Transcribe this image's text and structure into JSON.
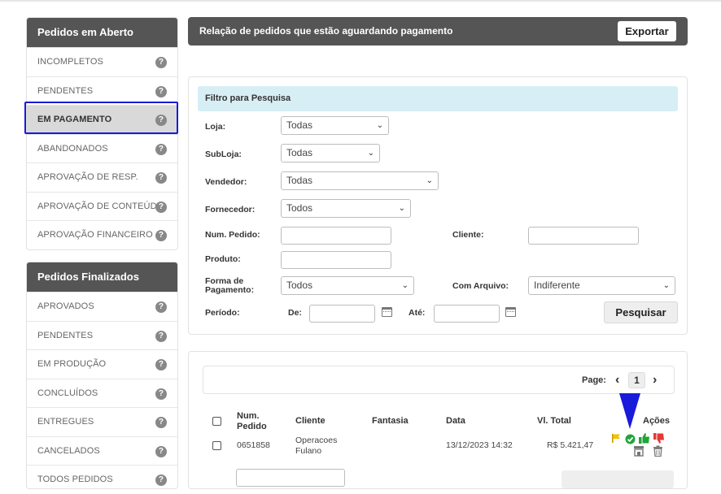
{
  "sidebar": {
    "open_title": "Pedidos em Aberto",
    "open_items": [
      {
        "label": "INCOMPLETOS",
        "active": false
      },
      {
        "label": "PENDENTES",
        "active": false
      },
      {
        "label": "EM PAGAMENTO",
        "active": true
      },
      {
        "label": "ABANDONADOS",
        "active": false
      },
      {
        "label": "APROVAÇÃO DE RESP.",
        "active": false
      },
      {
        "label": "APROVAÇÃO DE CONTEÚDO",
        "active": false
      },
      {
        "label": "APROVAÇÃO FINANCEIRO",
        "active": false
      }
    ],
    "closed_title": "Pedidos Finalizados",
    "closed_items": [
      {
        "label": "APROVADOS"
      },
      {
        "label": "PENDENTES"
      },
      {
        "label": "EM PRODUÇÃO"
      },
      {
        "label": "CONCLUÍDOS"
      },
      {
        "label": "ENTREGUES"
      },
      {
        "label": "CANCELADOS"
      },
      {
        "label": "TODOS PEDIDOS"
      }
    ],
    "help_glyph": "?"
  },
  "header": {
    "title": "Relação de pedidos que estão aguardando pagamento",
    "export_label": "Exportar"
  },
  "filter": {
    "title": "Filtro para Pesquisa",
    "loja_label": "Loja:",
    "loja_value": "Todas",
    "subloja_label": "SubLoja:",
    "subloja_value": "Todas",
    "vendedor_label": "Vendedor:",
    "vendedor_value": "Todas",
    "fornecedor_label": "Fornecedor:",
    "fornecedor_value": "Todos",
    "num_pedido_label": "Num. Pedido:",
    "cliente_label": "Cliente:",
    "produto_label": "Produto:",
    "forma_pagamento_label_1": "Forma de",
    "forma_pagamento_label_2": "Pagamento:",
    "forma_pagamento_value": "Todos",
    "com_arquivo_label": "Com Arquivo:",
    "com_arquivo_value": "Indiferente",
    "periodo_label": "Período:",
    "de_label": "De:",
    "ate_label": "Até:",
    "search_label": "Pesquisar"
  },
  "results": {
    "page_label": "Page:",
    "current_page": "1",
    "columns": {
      "num_pedido_1": "Num.",
      "num_pedido_2": "Pedido",
      "cliente": "Cliente",
      "fantasia": "Fantasia",
      "data": "Data",
      "vl_total": "Vl. Total",
      "acoes": "Ações"
    },
    "rows": [
      {
        "num_pedido": "0651858",
        "cliente_1": "Operacoes",
        "cliente_2": "Fulano",
        "fantasia": "",
        "data": "13/12/2023 14:32",
        "vl_total": "R$ 5.421,47"
      }
    ]
  },
  "colors": {
    "header_bg": "#555555",
    "filter_title_bg": "#d7eef5",
    "highlight_outline": "#1a1adb",
    "approve_green": "#22a43a",
    "reject_red": "#e53935",
    "flag_yellow": "#f5c000"
  }
}
